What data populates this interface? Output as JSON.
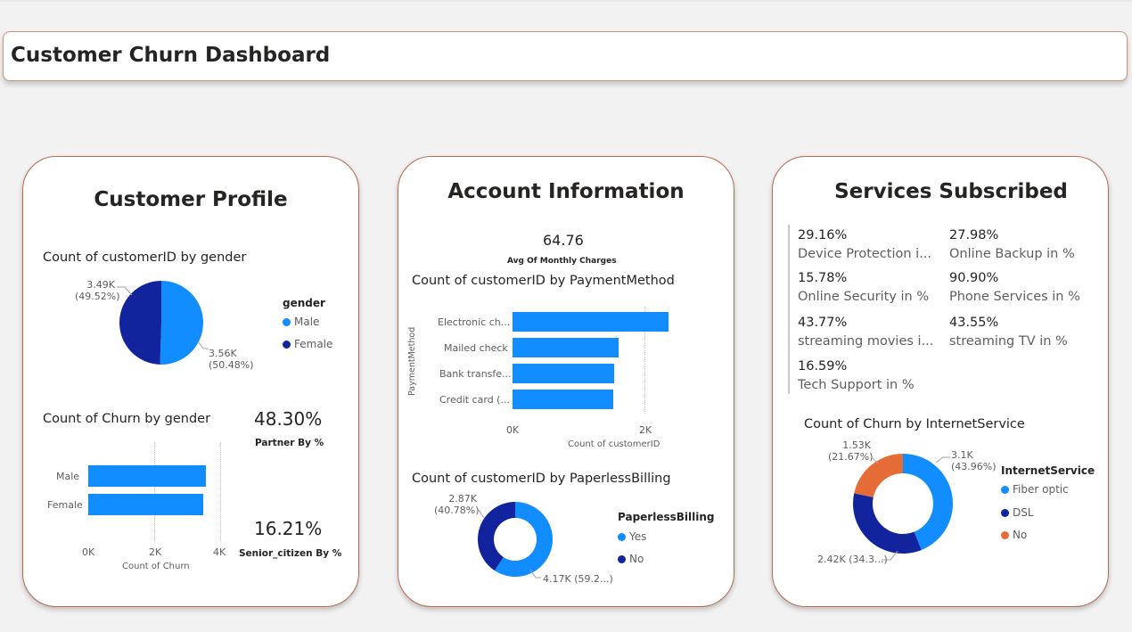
{
  "header": {
    "title": "Customer Churn Dashboard"
  },
  "profile": {
    "title": "Customer Profile",
    "gender_pie": {
      "title": "Count of customerID by gender",
      "legend_title": "gender",
      "slices": [
        {
          "name": "Male",
          "label": "3.56K",
          "pct": "(50.48%)",
          "value": 3560,
          "color": "#118dff"
        },
        {
          "name": "Female",
          "label": "3.49K",
          "pct": "(49.52%)",
          "value": 3490,
          "color": "#12239e"
        }
      ]
    },
    "churn_bar": {
      "title": "Count of Churn by gender",
      "categories": [
        "Male",
        "Female"
      ],
      "values": [
        3560,
        3490
      ],
      "ticks": [
        "0K",
        "2K",
        "4K"
      ],
      "xlabel": "Count of Churn"
    },
    "partner": {
      "value": "48.30%",
      "caption": "Partner By %"
    },
    "senior": {
      "value": "16.21%",
      "caption": "Senior_citizen By %"
    }
  },
  "account": {
    "title": "Account Information",
    "avg": {
      "value": "64.76",
      "caption": "Avg Of Monthly Charges"
    },
    "payment_bar": {
      "title": "Count of customerID by PaymentMethod",
      "categories": [
        "Electronic ch...",
        "Mailed check",
        "Bank transfe...",
        "Credit card (..."
      ],
      "values": [
        2365,
        1612,
        1544,
        1522
      ],
      "ticks": [
        "0K",
        "2K"
      ],
      "xlabel": "Count of customerID",
      "ylabel": "PaymentMethod"
    },
    "paperless": {
      "title": "Count of customerID by PaperlessBilling",
      "legend_title": "PaperlessBilling",
      "slices": [
        {
          "name": "Yes",
          "label": "4.17K (59.2...)",
          "value": 4170,
          "color": "#118dff"
        },
        {
          "name": "No",
          "label": "2.87K",
          "pct": "(40.78%)",
          "value": 2870,
          "color": "#12239e"
        }
      ]
    }
  },
  "services": {
    "title": "Services Subscribed",
    "stats": [
      {
        "value": "29.16%",
        "label": "Device Protection i..."
      },
      {
        "value": "27.98%",
        "label": "Online Backup in %"
      },
      {
        "value": "15.78%",
        "label": "Online Security in %"
      },
      {
        "value": "90.90%",
        "label": "Phone Services in %"
      },
      {
        "value": "43.77%",
        "label": "streaming movies i..."
      },
      {
        "value": "43.55%",
        "label": "streaming TV in %"
      },
      {
        "value": "16.59%",
        "label": "Tech Support in %"
      }
    ],
    "internet": {
      "title": "Count of Churn by InternetService",
      "legend_title": "InternetService",
      "slices": [
        {
          "name": "Fiber optic",
          "label": "3.1K",
          "pct": "(43.96%)",
          "value": 3096,
          "color": "#118dff"
        },
        {
          "name": "DSL",
          "label": "2.42K (34.3...)",
          "value": 2421,
          "color": "#12239e"
        },
        {
          "name": "No",
          "label": "1.53K",
          "pct": "(21.67%)",
          "value": 1526,
          "color": "#e66c37"
        }
      ]
    }
  },
  "chart_data": [
    {
      "type": "pie",
      "title": "Count of customerID by gender",
      "categories": [
        "Male",
        "Female"
      ],
      "values": [
        3560,
        3490
      ]
    },
    {
      "type": "bar",
      "title": "Count of Churn by gender",
      "categories": [
        "Male",
        "Female"
      ],
      "values": [
        3560,
        3490
      ],
      "xlabel": "Count of Churn",
      "xlim": [
        0,
        4000
      ]
    },
    {
      "type": "bar",
      "title": "Count of customerID by PaymentMethod",
      "categories": [
        "Electronic ch...",
        "Mailed check",
        "Bank transfe...",
        "Credit card (..."
      ],
      "values": [
        2365,
        1612,
        1544,
        1522
      ],
      "xlabel": "Count of customerID",
      "ylabel": "PaymentMethod",
      "xlim": [
        0,
        2400
      ]
    },
    {
      "type": "pie",
      "title": "Count of customerID by PaperlessBilling",
      "categories": [
        "Yes",
        "No"
      ],
      "values": [
        4170,
        2870
      ]
    },
    {
      "type": "pie",
      "title": "Count of Churn by InternetService",
      "categories": [
        "Fiber optic",
        "DSL",
        "No"
      ],
      "values": [
        3096,
        2421,
        1526
      ]
    }
  ]
}
